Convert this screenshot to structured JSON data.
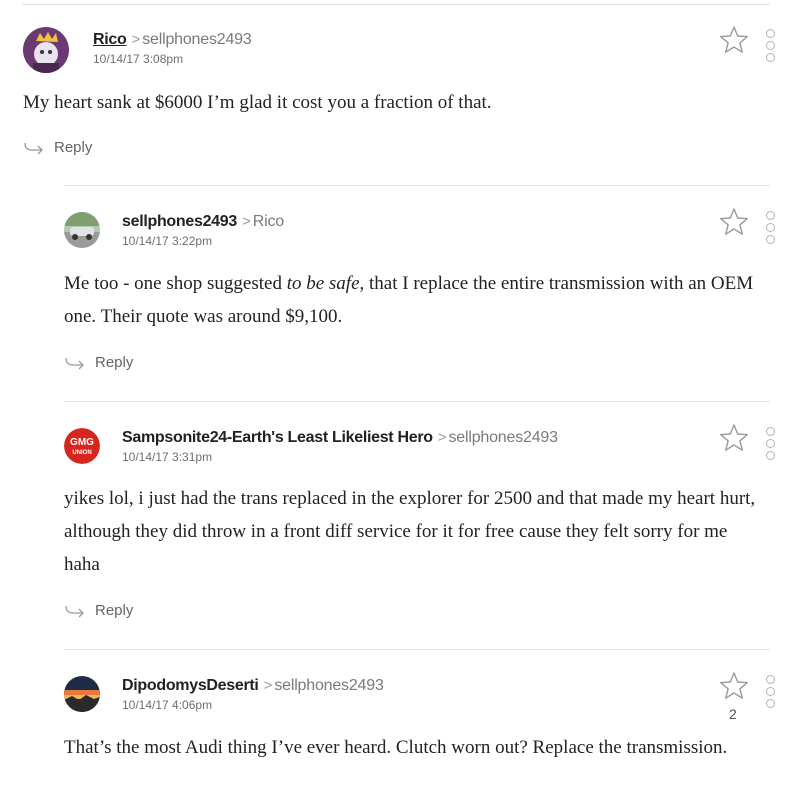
{
  "comments": [
    {
      "author": "Rico",
      "reply_to": "sellphones2493",
      "date": "10/14/17 3:08pm",
      "body": "My heart sank at $6000 I’m glad it cost you a fraction of that.",
      "reply_label": "Reply"
    },
    {
      "author": "sellphones2493",
      "reply_to": "Rico",
      "date": "10/14/17 3:22pm",
      "body_pre": "Me too - one shop suggested ",
      "body_em": "to be safe",
      "body_post": ", that I replace the entire transmission with an OEM one. Their quote was around $9,100.",
      "reply_label": "Reply"
    },
    {
      "author": "Sampsonite24-Earth's Least Likeliest Hero",
      "reply_to": "sellphones2493",
      "date": "10/14/17 3:31pm",
      "avatar_text_top": "GMG",
      "avatar_text_bottom": "UNION",
      "body": "yikes lol, i just had the trans replaced in the explorer for 2500 and that made my heart hurt, although they did throw in a front diff service for it for free cause they felt sorry for me haha",
      "reply_label": "Reply"
    },
    {
      "author": "DipodomysDeserti",
      "reply_to": "sellphones2493",
      "date": "10/14/17 4:06pm",
      "star_count": "2",
      "body": "That’s the most Audi thing I’ve ever heard. Clutch worn out? Replace the transmission."
    }
  ],
  "colors": {
    "gmg_red": "#d7261e",
    "muted": "#7a7a7a"
  }
}
